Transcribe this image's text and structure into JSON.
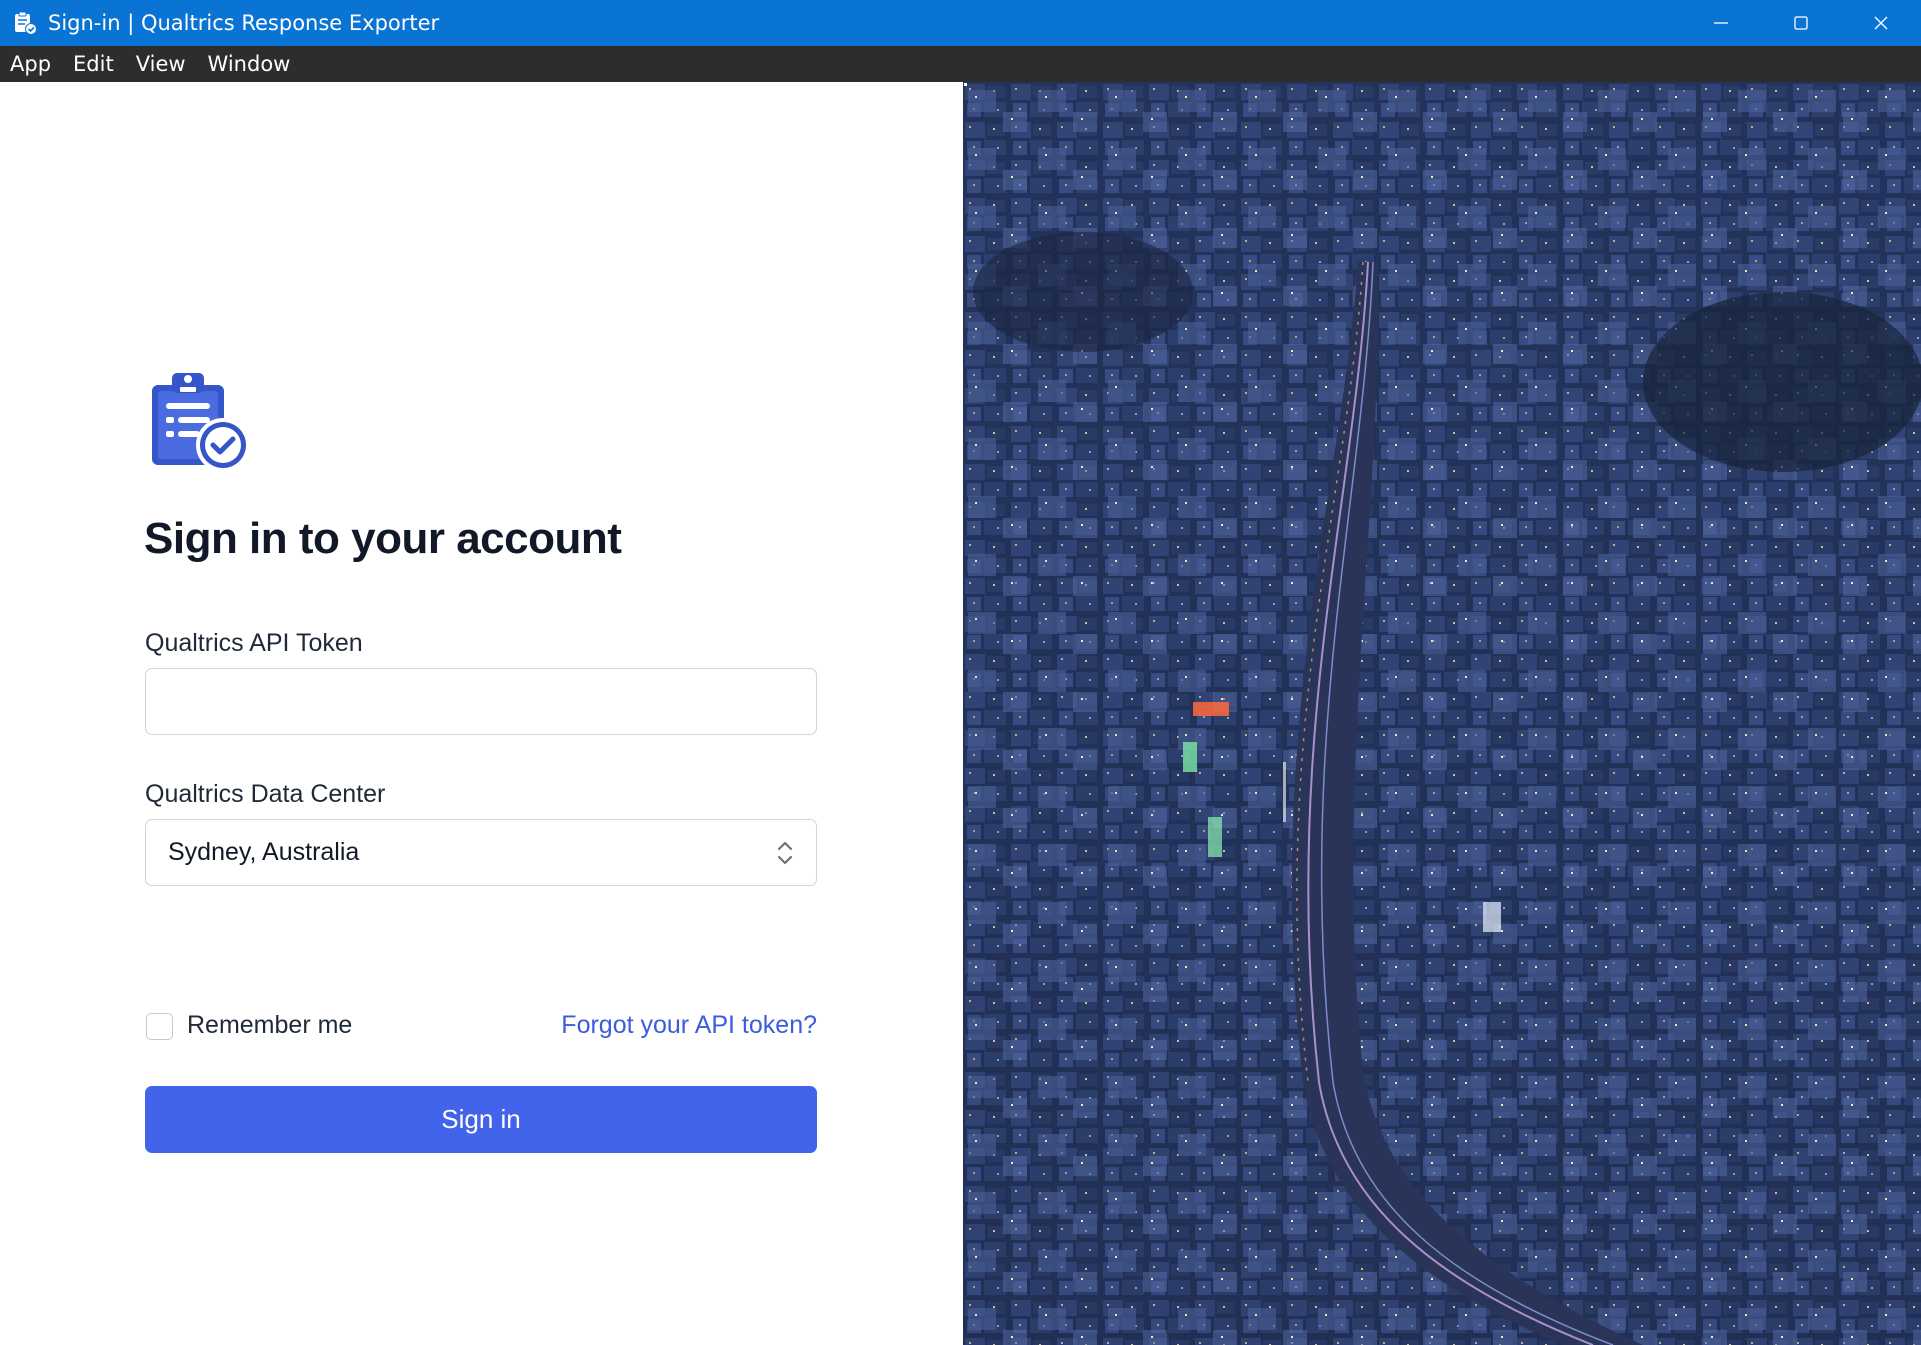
{
  "window": {
    "title": "Sign-in | Qualtrics Response Exporter",
    "controls": [
      "minimize-icon",
      "maximize-icon",
      "close-icon"
    ]
  },
  "menu": {
    "items": [
      "App",
      "Edit",
      "View",
      "Window"
    ]
  },
  "form": {
    "heading": "Sign in to your account",
    "token_label": "Qualtrics API Token",
    "token_value": "",
    "datacenter_label": "Qualtrics Data Center",
    "datacenter_value": "Sydney, Australia",
    "remember_label": "Remember me",
    "remember_checked": false,
    "forgot_link": "Forgot your API token?",
    "signin_label": "Sign in"
  },
  "theme": {
    "titlebar": "#0a74d4",
    "menubar": "#2d2d2d",
    "accent": "#4264eb",
    "link": "#3b5be0"
  },
  "image": {
    "description_icon": "city-night-aerial-image"
  }
}
